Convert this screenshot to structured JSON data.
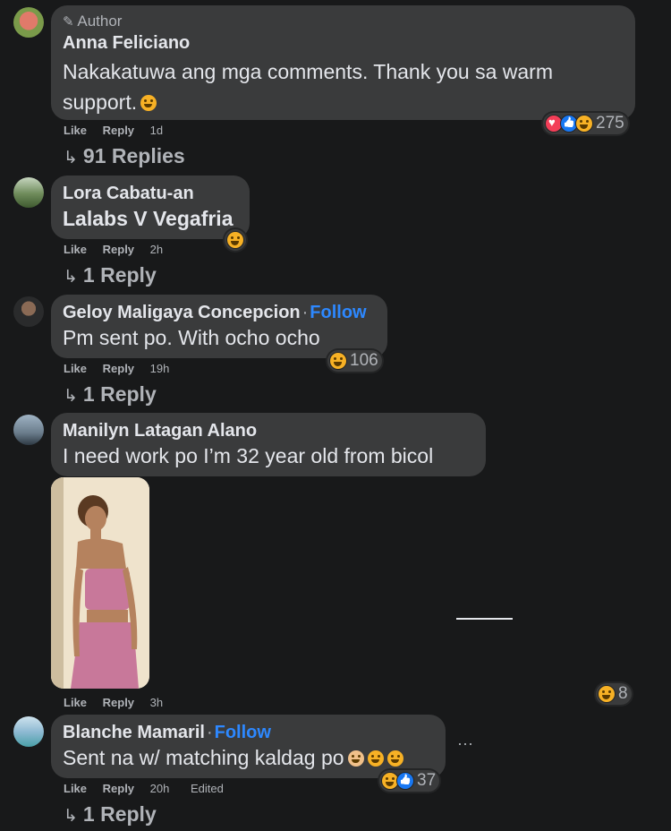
{
  "comments": [
    {
      "badge": "Author",
      "name": "Anna Feliciano",
      "text_line1": "Nakakatuwa ang mga comments. Thank you sa warm",
      "text_line2": "support.",
      "like": "Like",
      "reply": "Reply",
      "time": "1d",
      "reactions": [
        "love",
        "like",
        "haha"
      ],
      "reaction_count": "275",
      "replies": "91 Replies"
    },
    {
      "name": "Lora Cabatu-an",
      "text": "Lalabs V Vegafria",
      "like": "Like",
      "reply": "Reply",
      "time": "2h",
      "reactions": [
        "haha"
      ],
      "replies": "1 Reply"
    },
    {
      "name": "Geloy Maligaya Concepcion",
      "follow": "Follow",
      "text": "Pm sent po. With ocho ocho",
      "like": "Like",
      "reply": "Reply",
      "time": "19h",
      "reactions": [
        "haha"
      ],
      "reaction_count": "106",
      "replies": "1 Reply"
    },
    {
      "name": "Manilyn Latagan Alano",
      "text": "I need work po I’m 32 year old from bicol",
      "like": "Like",
      "reply": "Reply",
      "time": "3h",
      "reactions": [
        "haha"
      ],
      "reaction_count": "8"
    },
    {
      "name": "Blanche Mamaril",
      "follow": "Follow",
      "text": "Sent na w/ matching kaldag po",
      "like": "Like",
      "reply": "Reply",
      "time": "20h",
      "edited": "Edited",
      "reactions": [
        "haha",
        "like"
      ],
      "reaction_count": "37",
      "replies": "1 Reply",
      "more": "···"
    }
  ],
  "colors": {
    "background": "#18191a",
    "bubble": "#3a3b3c",
    "follow": "#2d88ff",
    "muted": "#b0b3b8"
  }
}
